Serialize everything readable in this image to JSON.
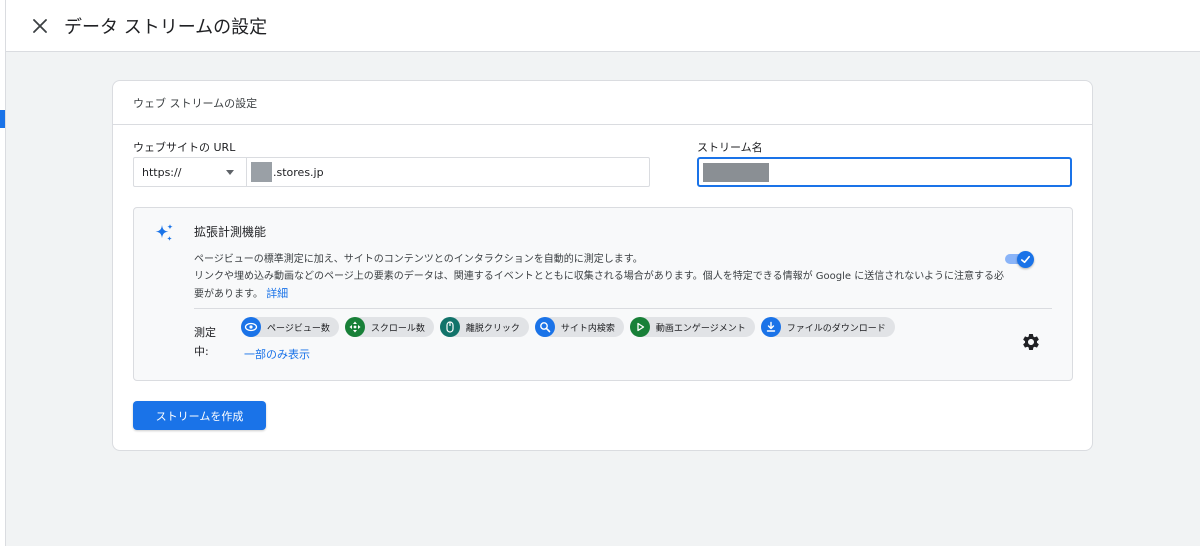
{
  "dialog": {
    "title": "データ ストリームの設定",
    "close_icon": "close-icon"
  },
  "card": {
    "header": "ウェブ ストリームの設定",
    "url_label": "ウェブサイトの URL",
    "protocol": "https://",
    "domain_suffix": ".stores.jp",
    "stream_name_label": "ストリーム名"
  },
  "enhanced": {
    "title": "拡張計測機能",
    "description_line1": "ページビューの標準測定に加え、サイトのコンテンツとのインタラクションを自動的に測定します。",
    "description_line2": "リンクや埋め込み動画などのページ上の要素のデータは、関連するイベントとともに収集される場合があります。個人を特定できる情報が Google に送信されないように注意する必要があります。",
    "details_link": "詳細",
    "toggle_on": true,
    "measuring_label": "測定中:",
    "show_partial_link": "一部のみ表示",
    "chips": [
      {
        "label": "ページビュー数",
        "icon": "eye-icon",
        "color": "#1a73e8"
      },
      {
        "label": "スクロール数",
        "icon": "scroll-arrows-icon",
        "color": "#188038"
      },
      {
        "label": "離脱クリック",
        "icon": "mouse-icon",
        "color": "#12736a"
      },
      {
        "label": "サイト内検索",
        "icon": "search-icon",
        "color": "#1a73e8"
      },
      {
        "label": "動画エンゲージメント",
        "icon": "play-icon",
        "color": "#188038"
      },
      {
        "label": "ファイルのダウンロード",
        "icon": "download-icon",
        "color": "#1a73e8"
      }
    ]
  },
  "create_button": "ストリームを作成",
  "colors": {
    "accent": "#1a73e8",
    "background": "#f1f3f4"
  }
}
